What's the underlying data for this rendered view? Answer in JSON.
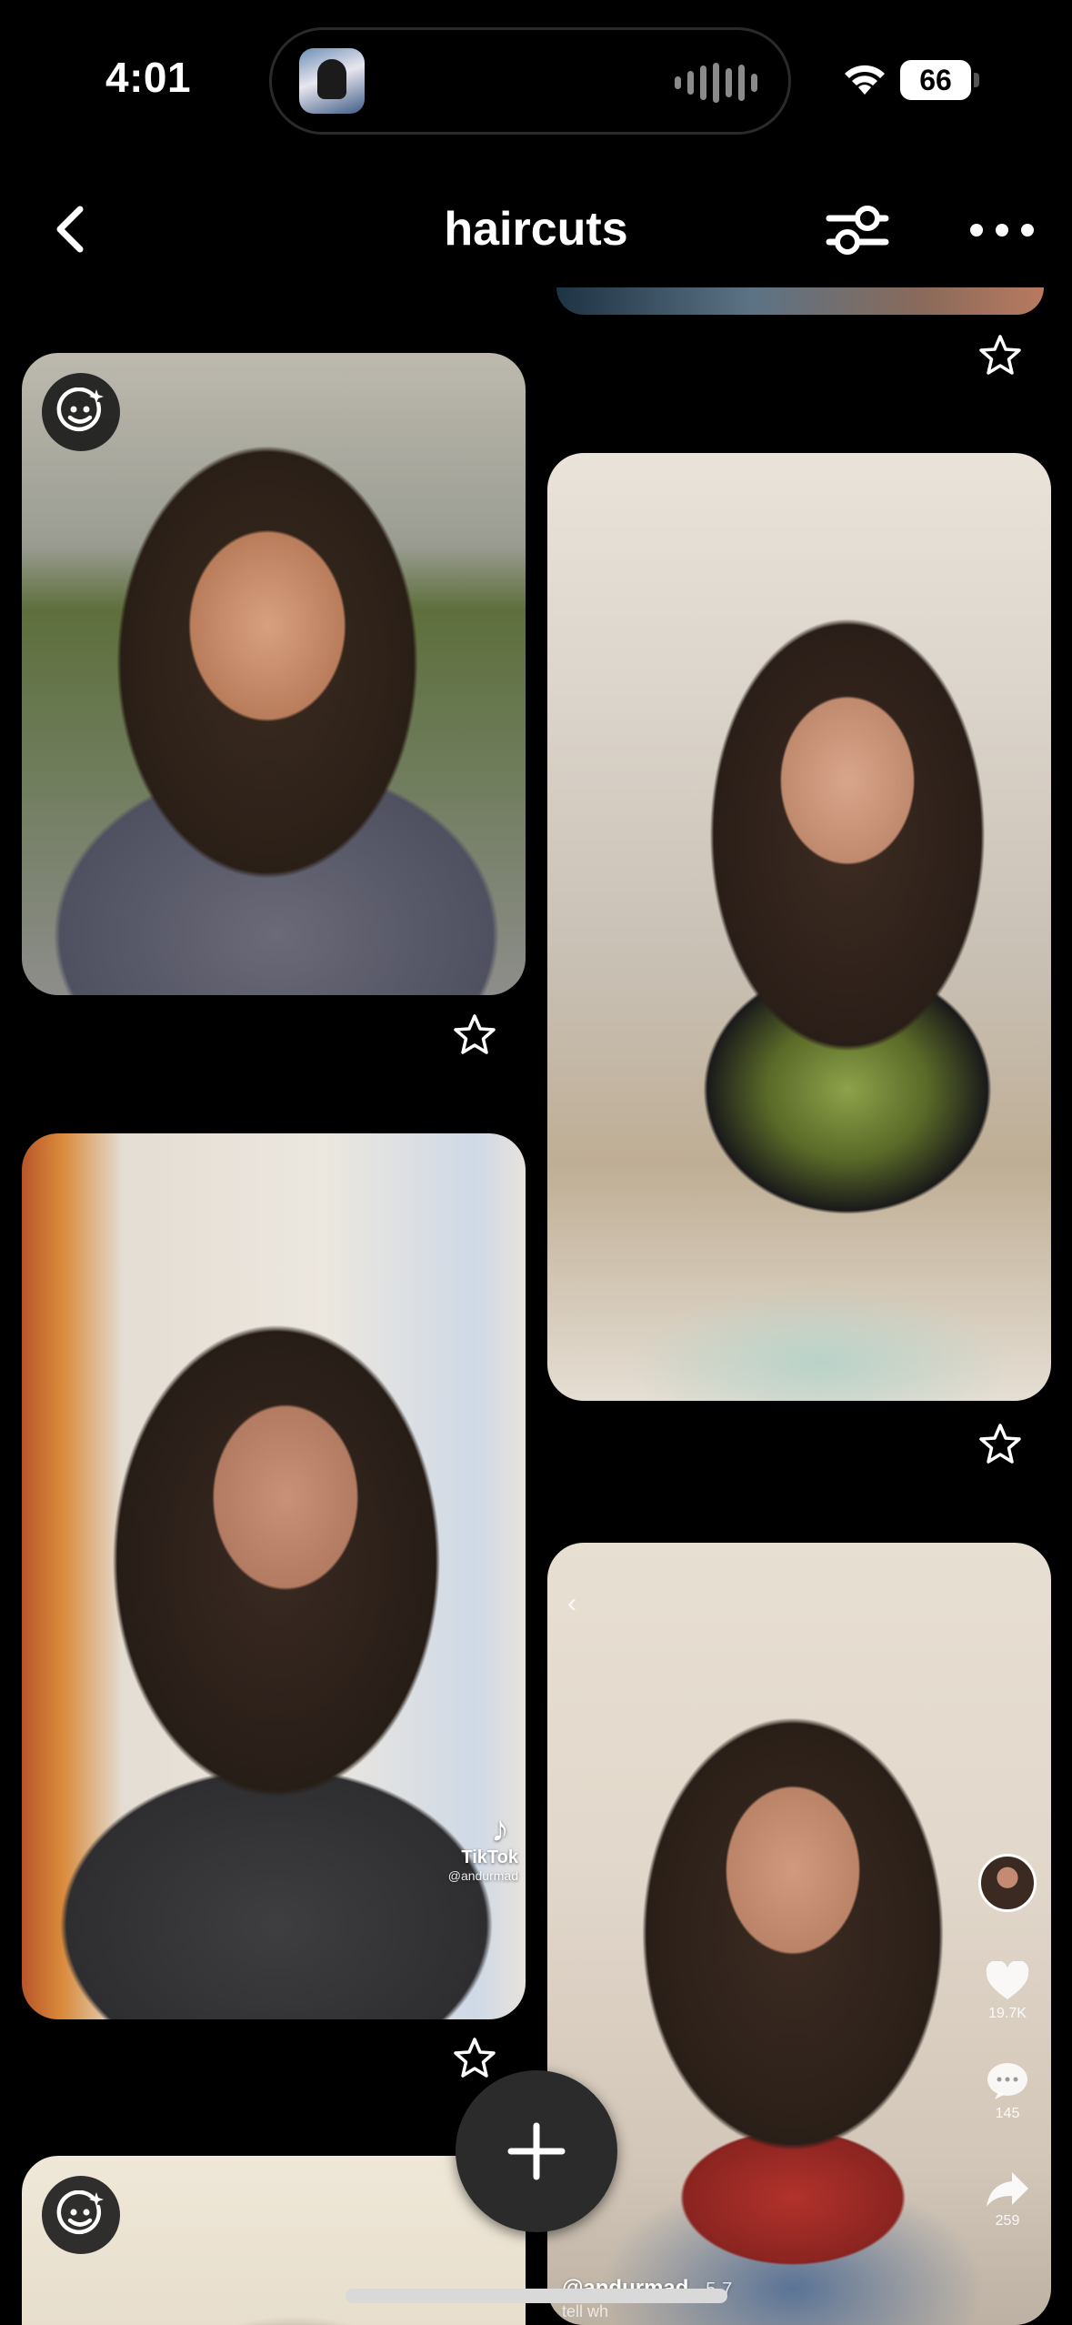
{
  "status_bar": {
    "time": "4:01",
    "battery": "66"
  },
  "header": {
    "title": "haircuts"
  },
  "pins": {
    "pin_4": {
      "likes": "19.7K",
      "comments": "145",
      "shares": "259",
      "author": "@andurmad",
      "date": "· 5-7",
      "sub": "tell wh"
    },
    "pin_3": {
      "watermark_brand": "TikTok",
      "watermark_handle": "@andurmad"
    }
  },
  "colors": {
    "background": "#000000",
    "fab": "#2b2b2b",
    "text": "#ffffff"
  },
  "icons": {
    "back": "chevron-left-icon",
    "filter": "sliders-icon",
    "more": "more-horizontal-icon",
    "save": "star-outline-icon",
    "ai": "sparkle-face-icon",
    "add": "plus-icon"
  }
}
